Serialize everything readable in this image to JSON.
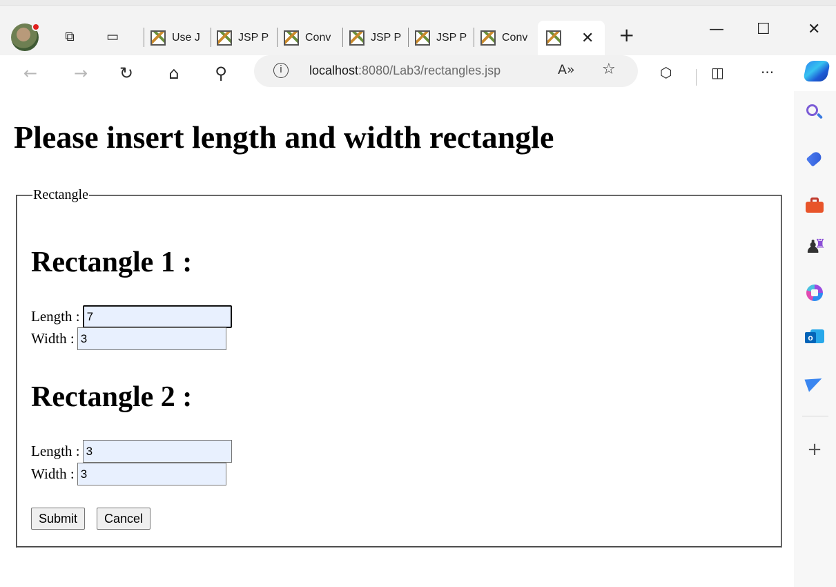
{
  "browser": {
    "tabs": [
      {
        "title": "Use J"
      },
      {
        "title": "JSP P"
      },
      {
        "title": "Conv"
      },
      {
        "title": "JSP P"
      },
      {
        "title": "JSP P"
      },
      {
        "title": "Conv"
      }
    ],
    "active_tab": {
      "title": "",
      "close_glyph": "✕"
    },
    "new_tab_glyph": "+",
    "window_controls": {
      "minimize": "—",
      "maximize": "☐",
      "close": "✕"
    },
    "address": {
      "host": "localhost",
      "path": ":8080/Lab3/rectangles.jsp",
      "info_glyph": "i"
    },
    "icons": [
      "profile-avatar",
      "workspaces-icon",
      "tab-actions-icon",
      "back-icon",
      "forward-icon",
      "refresh-icon",
      "home-icon",
      "search-icon",
      "read-aloud-icon",
      "favorite-star-icon",
      "extensions-icon",
      "split-screen-icon",
      "more-icon",
      "copilot-icon"
    ],
    "toolbar_glyphs": {
      "back": "←",
      "forward": "→",
      "refresh": "↻",
      "home": "⌂",
      "search": "⚲",
      "read_aloud": "A»",
      "favorite": "☆",
      "extensions": "⬡",
      "split": "◫",
      "more": "···"
    }
  },
  "sidebar": {
    "icons": [
      "search-icon",
      "shopping-tag-icon",
      "tools-icon",
      "games-icon",
      "office-icon",
      "outlook-icon",
      "send-icon",
      "add-icon"
    ],
    "plus_glyph": "+",
    "games_glyph": "♟",
    "rook_glyph": "♜"
  },
  "page": {
    "title": "Please insert length and width rectangle",
    "fieldset_legend": "Rectangle",
    "rectangles": [
      {
        "heading": "Rectangle 1 :",
        "length_label": "Length :",
        "length_value": "7",
        "width_label": "Width :",
        "width_value": "3"
      },
      {
        "heading": "Rectangle 2 :",
        "length_label": "Length :",
        "length_value": "3",
        "width_label": "Width :",
        "width_value": "3"
      }
    ],
    "submit_label": "Submit",
    "cancel_label": "Cancel"
  }
}
